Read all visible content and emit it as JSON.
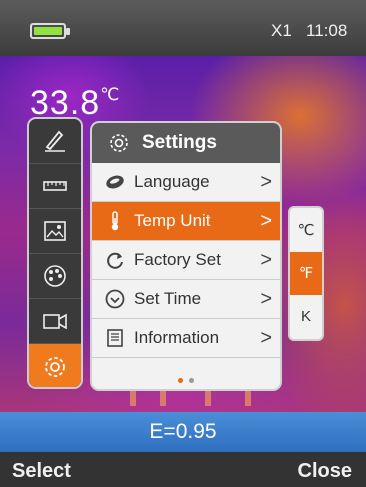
{
  "status": {
    "zoom": "X1",
    "time": "11:08",
    "battery_level": 1.0
  },
  "readout": {
    "value": "33.8",
    "unit": "℃"
  },
  "tools": [
    {
      "icon": "pen-icon"
    },
    {
      "icon": "ruler-icon"
    },
    {
      "icon": "image-icon"
    },
    {
      "icon": "palette-icon"
    },
    {
      "icon": "video-camera-icon"
    },
    {
      "icon": "gear-icon",
      "active": true
    }
  ],
  "settings": {
    "title": "Settings",
    "items": [
      {
        "label": "Language",
        "icon": "language-icon",
        "chevron": ">"
      },
      {
        "label": "Temp Unit",
        "icon": "thermometer-icon",
        "chevron": ">",
        "active": true
      },
      {
        "label": "Factory Set",
        "icon": "reset-icon",
        "chevron": ">"
      },
      {
        "label": "Set Time",
        "icon": "clock-icon",
        "chevron": ">"
      },
      {
        "label": "Information",
        "icon": "info-doc-icon",
        "chevron": ">"
      }
    ],
    "page": 1,
    "pages": 2
  },
  "temp_units": [
    {
      "label": "℃"
    },
    {
      "label": "℉",
      "selected": true
    },
    {
      "label": "K"
    }
  ],
  "emissivity": "E=0.95",
  "softkeys": {
    "left": "Select",
    "right": "Close"
  },
  "colors": {
    "accent": "#e86a16",
    "emissivity_bar": "#3b7ed0",
    "panel_header": "#5a5a5a"
  }
}
